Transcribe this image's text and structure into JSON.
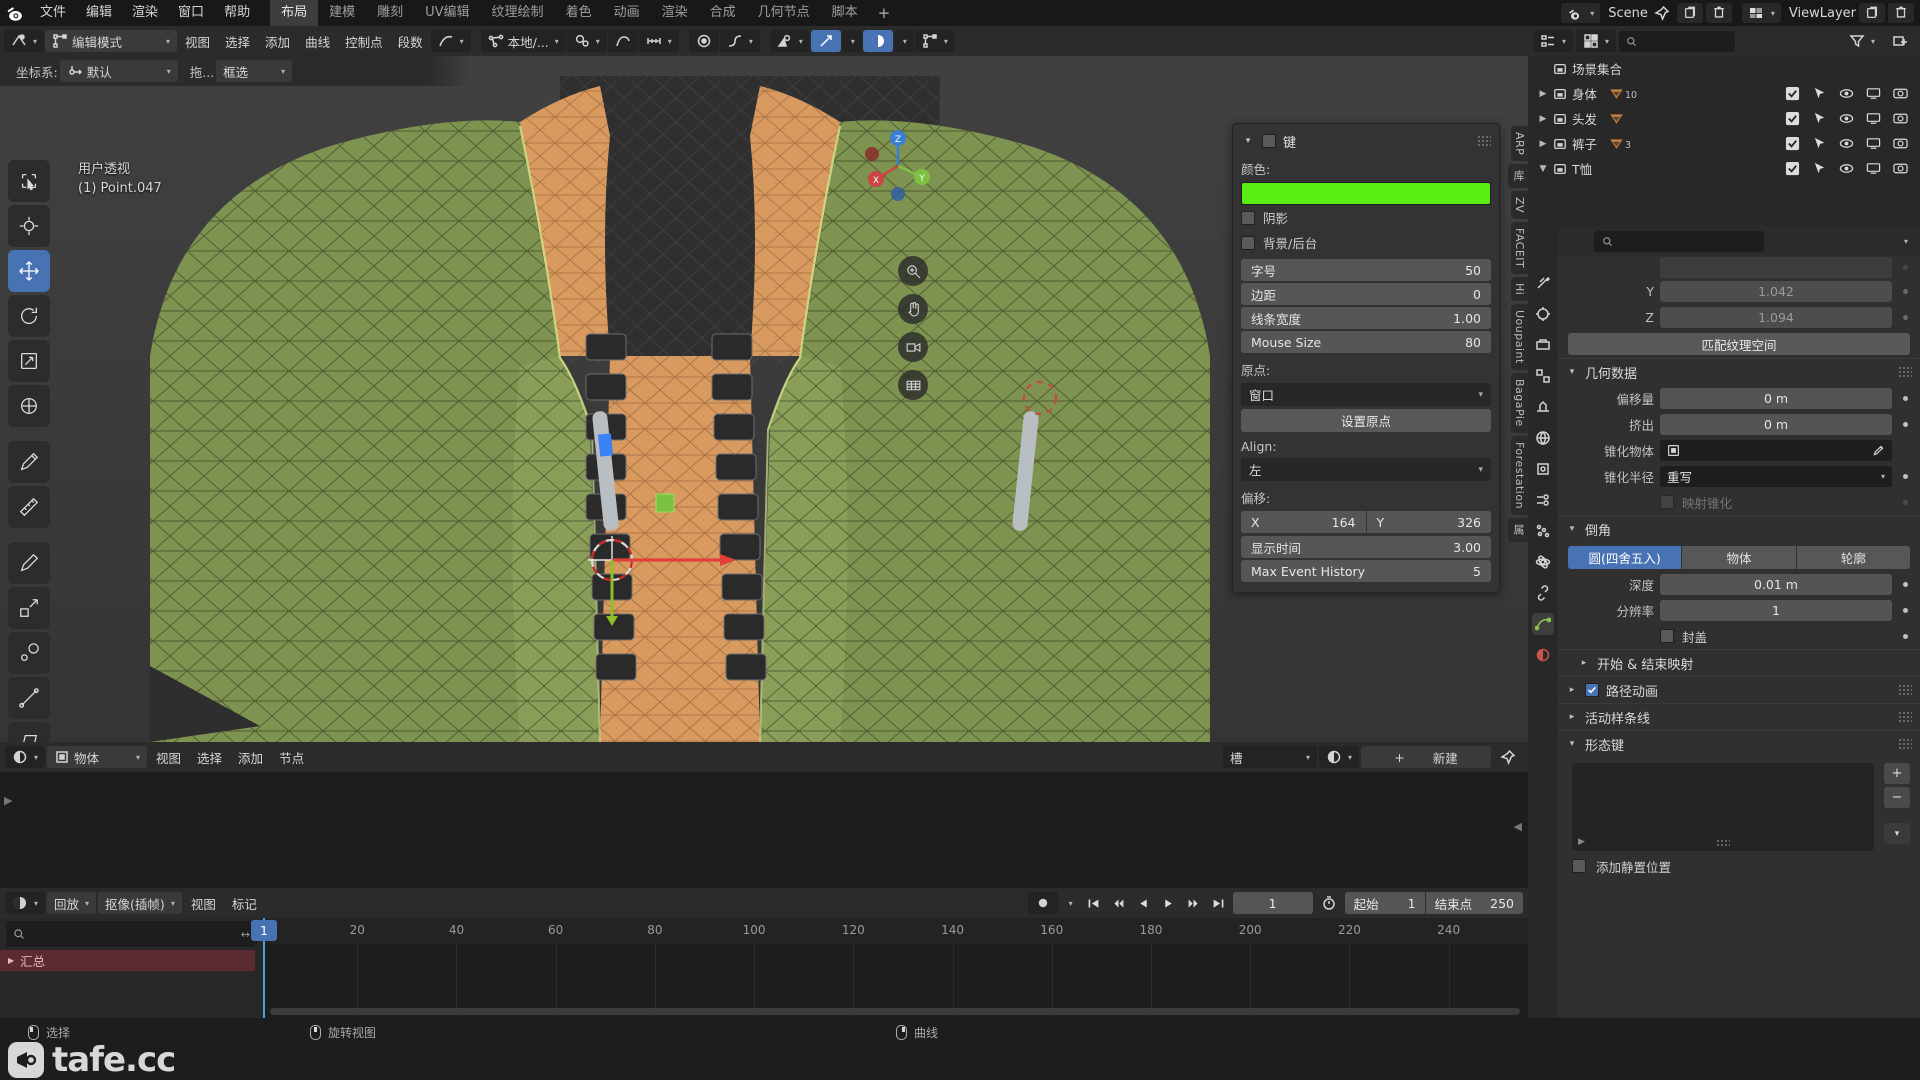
{
  "topbar": {
    "menus": [
      "文件",
      "编辑",
      "渲染",
      "窗口",
      "帮助"
    ],
    "workspaces": [
      {
        "label": "布局",
        "active": true
      },
      {
        "label": "建模",
        "active": false
      },
      {
        "label": "雕刻",
        "active": false
      },
      {
        "label": "UV编辑",
        "active": false
      },
      {
        "label": "纹理绘制",
        "active": false
      },
      {
        "label": "着色",
        "active": false
      },
      {
        "label": "动画",
        "active": false
      },
      {
        "label": "渲染",
        "active": false
      },
      {
        "label": "合成",
        "active": false
      },
      {
        "label": "几何节点",
        "active": false
      },
      {
        "label": "脚本",
        "active": false
      }
    ],
    "add_workspace": "+",
    "scene_name": "Scene",
    "viewlayer_name": "ViewLayer"
  },
  "viewport": {
    "header": {
      "mode": "编辑模式",
      "menus": [
        "视图",
        "选择",
        "添加",
        "曲线",
        "控制点",
        "段数"
      ],
      "orientation_label": "坐标系:",
      "orientation_value": "默认",
      "drag_label": "拖...",
      "drag_value": "框选",
      "snap_value": "本地/...",
      "proportional_icon": "proportional-editing-icon"
    },
    "overlay_line1": "用户透视",
    "overlay_line2": "(1) Point.047",
    "vertical_tabs": [
      "ARP",
      "库",
      "ZV",
      "FACEIT",
      "Hi",
      "Uoupaint",
      "BagaPie",
      "Forestation",
      "属"
    ],
    "tools": [
      "tweak-tool",
      "cursor-tool",
      "move-tool",
      "rotate-tool",
      "scale-tool",
      "transform-tool",
      "annotate-tool",
      "measure-tool",
      "draw-tool",
      "extrude-tool",
      "radius-tool",
      "tilt-tool",
      "shear-tool",
      "randomize-tool"
    ]
  },
  "popup": {
    "title": "键",
    "color_label": "颜色:",
    "color_value": "#5aee12",
    "shadow_label": "阴影",
    "background_label": "背景/后台",
    "numbers": [
      {
        "name": "字号",
        "value": "50"
      },
      {
        "name": "边距",
        "value": "0"
      },
      {
        "name": "线条宽度",
        "value": "1.00"
      },
      {
        "name": "Mouse Size",
        "value": "80"
      }
    ],
    "origin_label": "原点:",
    "origin_value": "窗口",
    "set_origin_button": "设置原点",
    "align_label": "Align:",
    "align_value": "左",
    "offset_label": "偏移:",
    "offset_x_name": "X",
    "offset_x_value": "164",
    "offset_y_name": "Y",
    "offset_y_value": "326",
    "display_time": {
      "name": "显示时间",
      "value": "3.00"
    },
    "max_event_history": {
      "name": "Max Event History",
      "value": "5"
    }
  },
  "node_editor": {
    "mode": "物体",
    "menus": [
      "视图",
      "选择",
      "添加",
      "节点"
    ],
    "slot_label": "槽",
    "new_button": "新建",
    "plus": "+"
  },
  "timeline": {
    "editor_menus": [
      "回放",
      "抠像(插帧)",
      "视图",
      "标记"
    ],
    "playback_label": "回放",
    "keying_label": "抠像(插帧)",
    "current_frame": "1",
    "start_label": "起始",
    "start_value": "1",
    "end_label": "结束点",
    "end_value": "250",
    "search_placeholder": "",
    "channel_name": "汇总",
    "ticks": [
      {
        "label": "1",
        "frame": 1
      },
      {
        "label": "20",
        "frame": 20
      },
      {
        "label": "40",
        "frame": 40
      },
      {
        "label": "60",
        "frame": 60
      },
      {
        "label": "80",
        "frame": 80
      },
      {
        "label": "100",
        "frame": 100
      },
      {
        "label": "120",
        "frame": 120
      },
      {
        "label": "140",
        "frame": 140
      },
      {
        "label": "160",
        "frame": 160
      },
      {
        "label": "180",
        "frame": 180
      },
      {
        "label": "200",
        "frame": 200
      },
      {
        "label": "220",
        "frame": 220
      },
      {
        "label": "240",
        "frame": 240
      }
    ]
  },
  "outliner": {
    "scene_collection": "场景集合",
    "rows": [
      {
        "name": "身体",
        "badge_count": "10",
        "expanded": false
      },
      {
        "name": "头发",
        "badge_count": "",
        "expanded": false
      },
      {
        "name": "裤子",
        "badge_count": "3",
        "expanded": false
      },
      {
        "name": "T恤",
        "badge_count": "",
        "expanded": true
      }
    ]
  },
  "properties": {
    "texture_space": {
      "y_label": "Y",
      "y_value": "1.042",
      "z_label": "Z",
      "z_value": "1.094",
      "match_button": "匹配纹理空间"
    },
    "geometry_section": "几何数据",
    "geometry": [
      {
        "label": "偏移量",
        "value": "0 m"
      },
      {
        "label": "挤出",
        "value": "0 m"
      }
    ],
    "taper_object_label": "锥化物体",
    "taper_radius_label": "锥化半径",
    "taper_radius_value": "重写",
    "map_taper_label": "映射锥化",
    "bevel_section": "倒角",
    "bevel_tabs": [
      {
        "label": "圆(四舍五入)",
        "active": true
      },
      {
        "label": "物体",
        "active": false
      },
      {
        "label": "轮廓",
        "active": false
      }
    ],
    "bevel_rows": [
      {
        "label": "深度",
        "value": "0.01 m"
      },
      {
        "label": "分辨率",
        "value": "1"
      }
    ],
    "fill_caps_label": "封盖",
    "start_end_mapping": "开始 & 结束映射",
    "path_animation": "路径动画",
    "active_spline": "活动样条线",
    "shape_keys": "形态键",
    "add_rest_position": "添加静置位置"
  },
  "statusbar": {
    "items": [
      {
        "icon": "mouse-left-icon",
        "label": "选择"
      },
      {
        "icon": "mouse-middle-icon",
        "label": "旋转视图"
      },
      {
        "icon": "mouse-right-icon",
        "label": "曲线"
      }
    ]
  },
  "watermark": {
    "text": "tafe.cc"
  },
  "colors": {
    "accent_blue": "#4772b3",
    "key_green": "#5aee12",
    "channel_red": "#5c2a33",
    "panel_bg": "#303030",
    "header_bg": "#2b2b2b"
  }
}
